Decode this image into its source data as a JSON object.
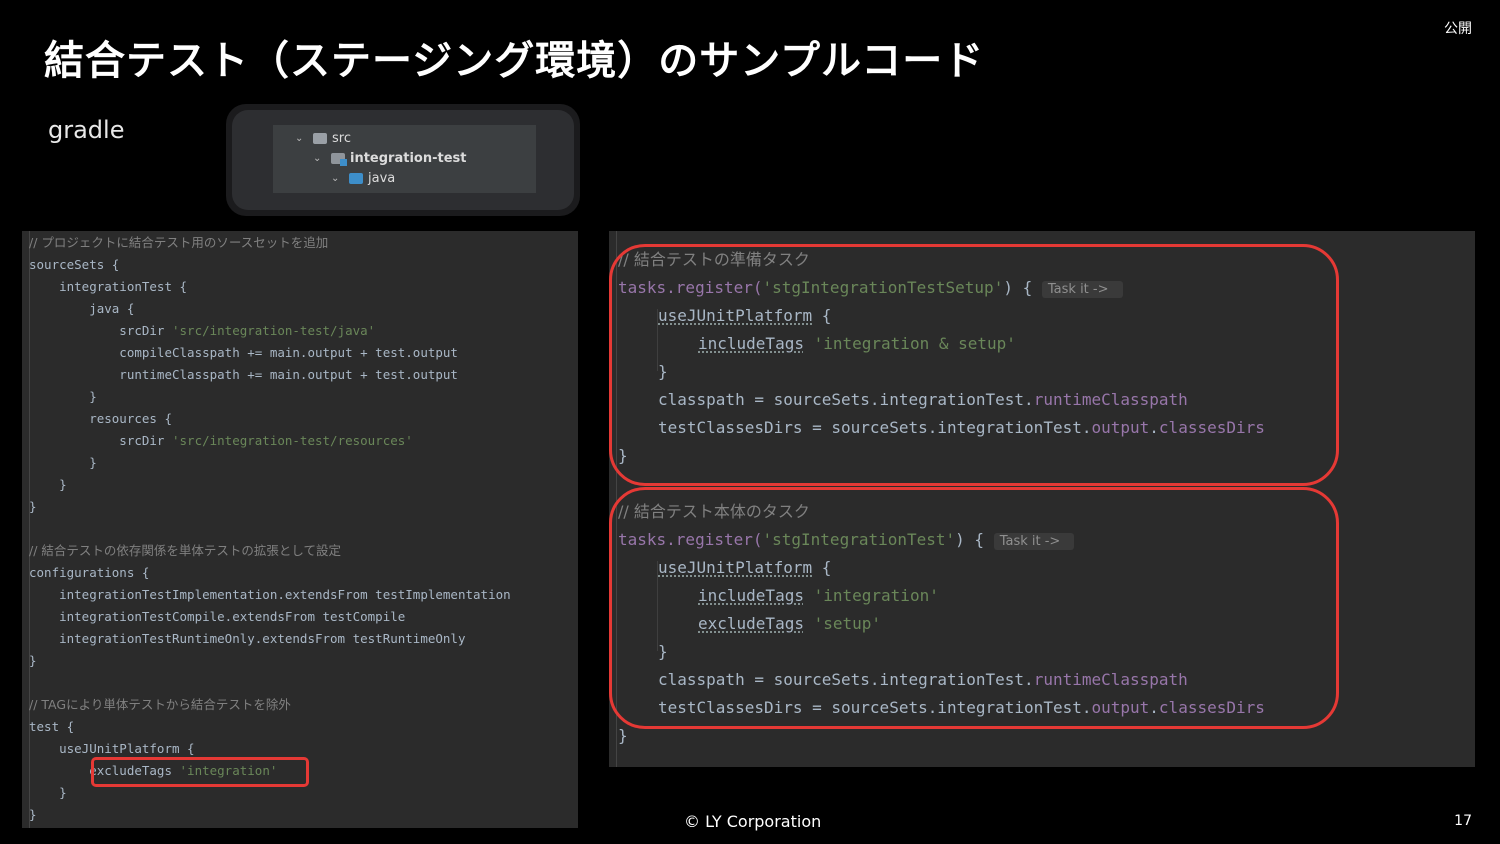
{
  "slide": {
    "title": "結合テスト（ステージング環境）のサンプルコード",
    "public_label": "公開",
    "gradle_label": "gradle",
    "footer": "© LY Corporation",
    "page_number": "17"
  },
  "project_tree": {
    "items": [
      {
        "chevron": "⌄",
        "name": "src",
        "icon": "folder-icon"
      },
      {
        "chevron": "⌄",
        "name": "integration-test",
        "icon": "source-folder-icon"
      },
      {
        "chevron": "⌄",
        "name": "java",
        "icon": "java-folder-icon"
      }
    ]
  },
  "left_code": {
    "lines": [
      "// プロジェクトに結合テスト用のソースセットを追加",
      "sourceSets {",
      "    integrationTest {",
      "        java {",
      "            srcDir",
      "'src/integration-test/java'",
      "            compileClasspath += main.output + test.output",
      "            runtimeClasspath += main.output + test.output",
      "        }",
      "        resources {",
      "            srcDir",
      "'src/integration-test/resources'",
      "        }",
      "    }",
      "}",
      "// 結合テストの依存関係を単体テストの拡張として設定",
      "configurations {",
      "    integrationTestImplementation.extendsFrom testImplementation",
      "    integrationTestCompile.extendsFrom testCompile",
      "    integrationTestRuntimeOnly.extendsFrom testRuntimeOnly",
      "}",
      "// TAGにより単体テストから結合テストを除外",
      "test {",
      "    useJUnitPlatform {",
      "        excludeTags",
      "'integration'",
      "    }",
      "}"
    ]
  },
  "right_code": {
    "setup_task": {
      "comment": "// 結合テストの準備タスク",
      "register_prefix": "tasks.register(",
      "task_name": "'stgIntegrationTestSetup'",
      "register_suffix": ") {",
      "hint": "Task it ->",
      "junit": "useJUnitPlatform",
      "brace_open": " {",
      "include_kw": "includeTags",
      "include_val": "'integration & setup'",
      "close_inner": "}",
      "classpath_prefix": "classpath = sourceSets.integrationTest.",
      "classpath_field": "runtimeClasspath",
      "dirs_prefix": "testClassesDirs = sourceSets.integrationTest.",
      "dirs_field1": "output",
      "dot": ".",
      "dirs_field2": "classesDirs",
      "close_outer": "}"
    },
    "main_task": {
      "comment": "// 結合テスト本体のタスク",
      "register_prefix": "tasks.register(",
      "task_name": "'stgIntegrationTest'",
      "register_suffix": ") {",
      "hint": "Task it ->",
      "junit": "useJUnitPlatform",
      "brace_open": " {",
      "include_kw": "includeTags",
      "include_val": "'integration'",
      "exclude_kw": "excludeTags",
      "exclude_val": "'setup'",
      "close_inner": "}",
      "classpath_prefix": "classpath = sourceSets.integrationTest.",
      "classpath_field": "runtimeClasspath",
      "dirs_prefix": "testClassesDirs = sourceSets.integrationTest.",
      "dirs_field1": "output",
      "dot": ".",
      "dirs_field2": "classesDirs",
      "close_outer": "}"
    }
  },
  "colors": {
    "code_bg": "#2b2b2b",
    "string": "#6a8759",
    "field": "#9876aa",
    "comment": "#808080",
    "highlight": "#e53935"
  }
}
